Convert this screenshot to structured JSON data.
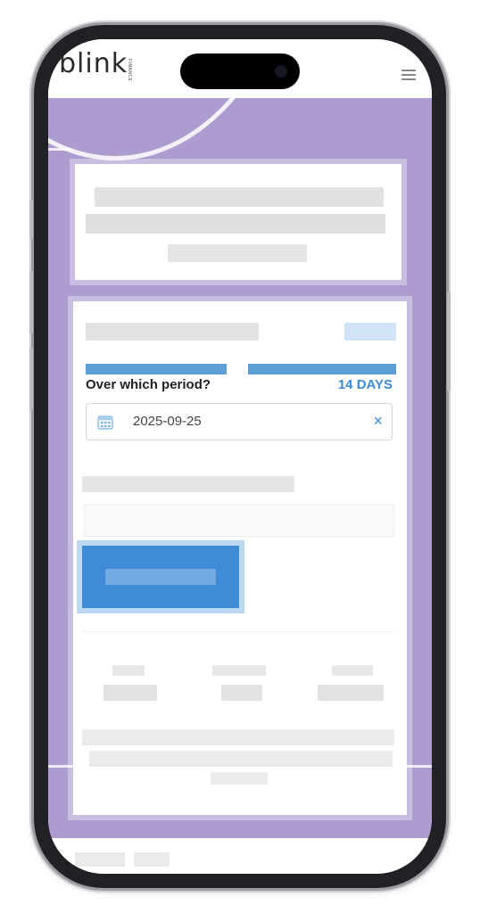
{
  "header": {
    "logo_text": "blink",
    "logo_subtext": "FINANCE",
    "menu_icon": "hamburger-menu-icon"
  },
  "calculator": {
    "period_label": "Over which period?",
    "period_value": "14 DAYS",
    "date_value": "2025-09-25",
    "date_icon": "calendar-icon",
    "clear_symbol": "×"
  },
  "colors": {
    "hero_background": "#ad9ccf",
    "accent_blue": "#3d8ad8",
    "bar_blue": "#5d9ed6",
    "button_blue": "#3f8bd6"
  }
}
